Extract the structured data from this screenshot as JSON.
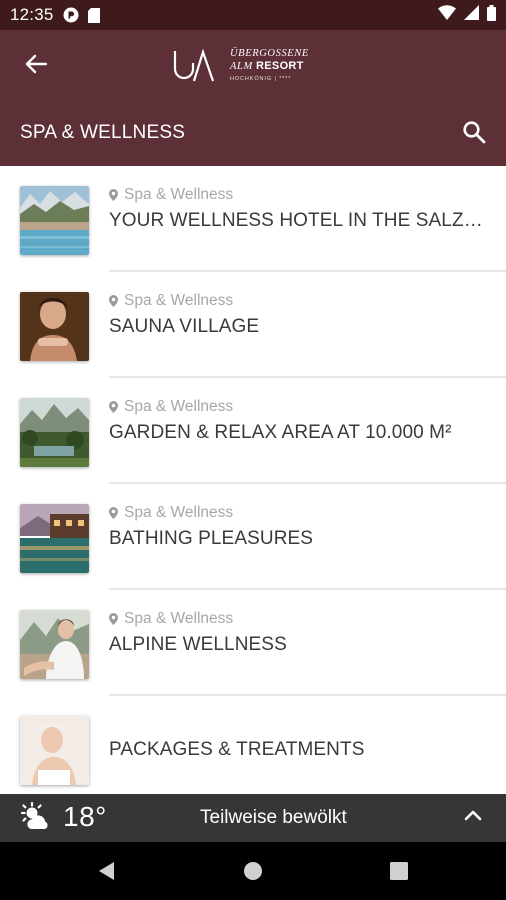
{
  "status_bar": {
    "time": "12:35",
    "icons": [
      "pocket-casts-icon",
      "sd-card-icon",
      "wifi-icon",
      "signal-icon",
      "battery-icon"
    ]
  },
  "header": {
    "back_icon": "arrow-left-icon",
    "logo": {
      "monogram": "UA",
      "line1": "ÜBERGOSSENE",
      "line2_italic": "ALM",
      "line2_bold": "RESORT",
      "line3": "HOCHKÖNIG | ****"
    },
    "section_title": "SPA & WELLNESS",
    "search_icon": "search-icon"
  },
  "list": {
    "items": [
      {
        "meta": "Spa & Wellness",
        "title": "YOUR WELLNESS HOTEL IN THE SALZBU...",
        "thumbnail": "pool-mountains"
      },
      {
        "meta": "Spa & Wellness",
        "title": "SAUNA VILLAGE",
        "thumbnail": "woman-sauna"
      },
      {
        "meta": "Spa & Wellness",
        "title": "GARDEN & RELAX AREA AT 10.000 M²",
        "thumbnail": "garden-forest"
      },
      {
        "meta": "Spa & Wellness",
        "title": "BATHING PLEASURES",
        "thumbnail": "outdoor-pool-dusk"
      },
      {
        "meta": "Spa & Wellness",
        "title": "ALPINE WELLNESS",
        "thumbnail": "woman-bathrobe"
      },
      {
        "meta": "",
        "title": "PACKAGES & TREATMENTS",
        "thumbnail": "woman-towel"
      }
    ]
  },
  "weather": {
    "icon": "partly-cloudy-icon",
    "temperature": "18°",
    "condition": "Teilweise bewölkt",
    "expand_icon": "chevron-up-icon"
  },
  "colors": {
    "status_bar": "#3f1a1d",
    "header": "#5d2f36",
    "weather_bar": "#363636",
    "nav_bar": "#000000",
    "meta_text": "#a7a7a7",
    "title_text": "#3a3a3a"
  }
}
